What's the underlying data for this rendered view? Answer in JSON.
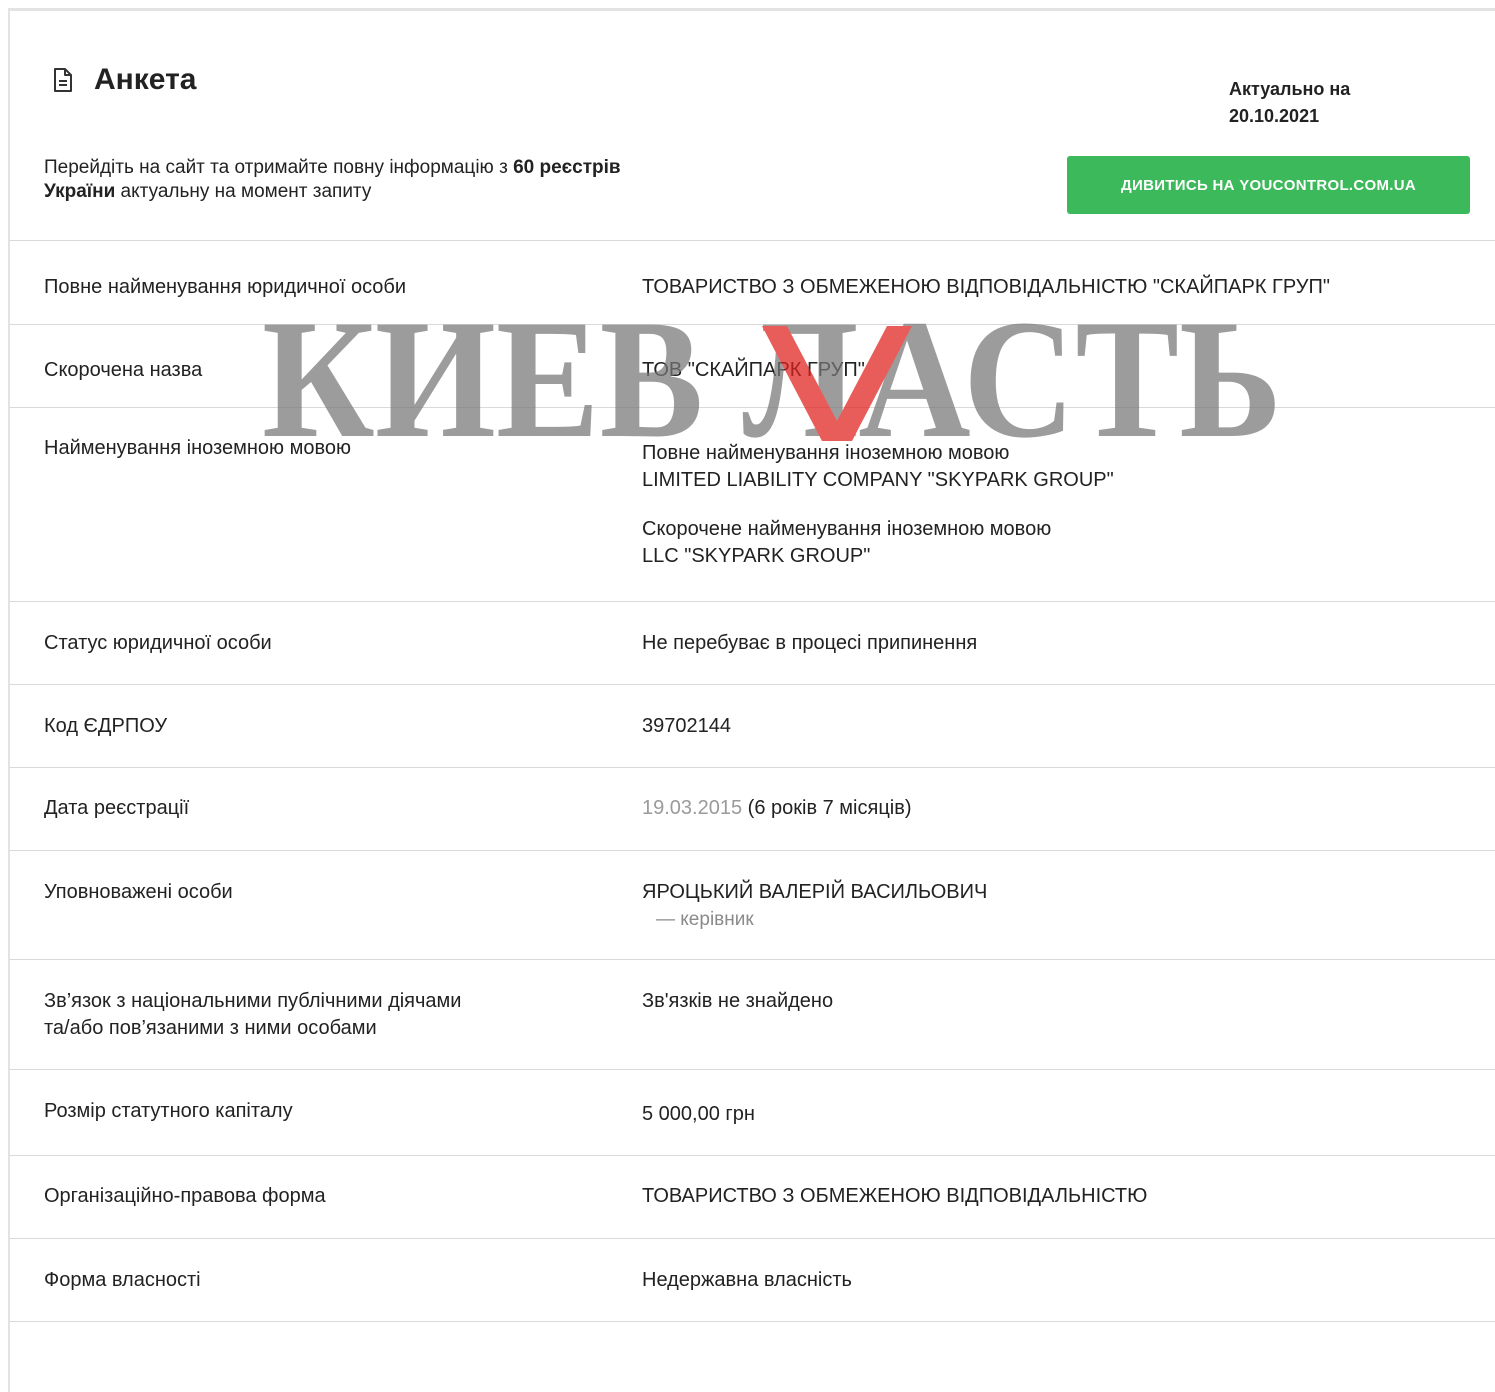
{
  "header": {
    "title": "Анкета",
    "actual_label": "Актуально на",
    "actual_date": "20.10.2021",
    "promo_text_1": "Перейдіть на сайт та отримайте повну інформацію з ",
    "promo_bold_1": "60 реєстрів України",
    "promo_text_2": " актуальну на момент запиту",
    "cta_label": "ДИВИТИСЬ НА YOUCONTROL.COM.UA"
  },
  "watermark_text": "КИЕВ ЛАСТЬ",
  "rows": [
    {
      "label": "Повне найменування юридичної особи",
      "value": "ТОВАРИСТВО З ОБМЕЖЕНОЮ ВІДПОВІДАЛЬНІСТЮ \"СКАЙПАРК ГРУП\""
    },
    {
      "label": "Скорочена назва",
      "value": "ТОВ \"СКАЙПАРК ГРУП\""
    },
    {
      "label": "Найменування іноземною мовою",
      "full_title": "Повне найменування іноземною мовою",
      "full_value": "LIMITED LIABILITY COMPANY \"SKYPARK GROUP\"",
      "short_title": "Скорочене найменування іноземною мовою",
      "short_value": "LLC \"SKYPARK GROUP\""
    },
    {
      "label": "Статус юридичної особи",
      "value": "Не перебуває в процесі припинення"
    },
    {
      "label": "Код ЄДРПОУ",
      "value": "39702144"
    },
    {
      "label": "Дата реєстрації",
      "date": "19.03.2015",
      "duration": " (6 років 7 місяців)"
    },
    {
      "label": "Уповноважені особи",
      "person": "ЯРОЦЬКИЙ ВАЛЕРІЙ ВАСИЛЬОВИЧ",
      "role": "— керівник"
    },
    {
      "label_1": "Зв’язок з національними публічними діячами",
      "label_2": "та/або пов’язаними з ними особами",
      "value": "Зв'язків не знайдено"
    },
    {
      "label": "Розмір статутного капіталу",
      "value": "5 000,00 грн"
    },
    {
      "label": "Організаційно-правова форма",
      "value": "ТОВАРИСТВО З ОБМЕЖЕНОЮ ВІДПОВІДАЛЬНІСТЮ"
    },
    {
      "label": "Форма власності",
      "value": "Недержавна власність"
    }
  ],
  "colors": {
    "accent": "#3cb95a",
    "watermark": "#777777",
    "watermark_v": "#e0201c"
  }
}
